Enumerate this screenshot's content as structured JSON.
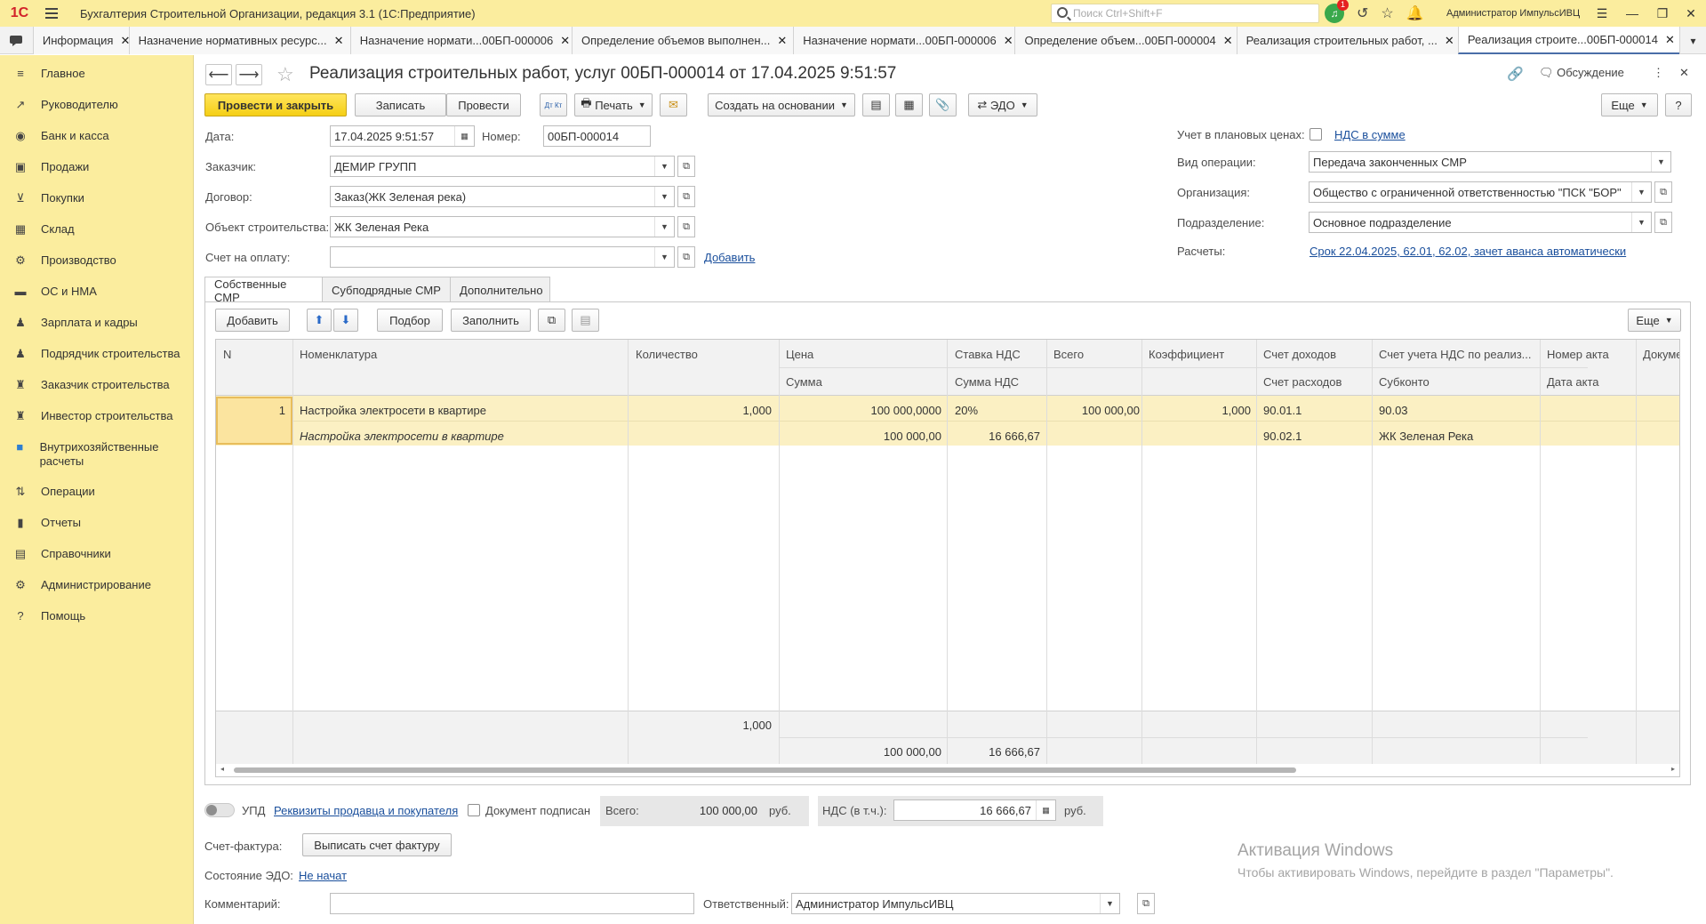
{
  "window": {
    "logo": "1С",
    "app_title": "Бухгалтерия Строительной Организации, редакция 3.1  (1С:Предприятие)",
    "search_placeholder": "Поиск Ctrl+Shift+F",
    "notification_count": "1",
    "user": "Администратор ИмпульсИВЦ"
  },
  "tabs": [
    {
      "label": "Информация"
    },
    {
      "label": "Назначение нормативных ресурс..."
    },
    {
      "label": "Назначение нормати...00БП-000006"
    },
    {
      "label": "Определение объемов выполнен..."
    },
    {
      "label": "Назначение нормати...00БП-000006"
    },
    {
      "label": "Определение объем...00БП-000004"
    },
    {
      "label": "Реализация строительных работ, ..."
    },
    {
      "label": "Реализация строите...00БП-000014"
    }
  ],
  "sidebar": {
    "items": [
      {
        "label": "Главное",
        "icon": "≡"
      },
      {
        "label": "Руководителю",
        "icon": "↗"
      },
      {
        "label": "Банк и касса",
        "icon": "◉"
      },
      {
        "label": "Продажи",
        "icon": "▣"
      },
      {
        "label": "Покупки",
        "icon": "⊻"
      },
      {
        "label": "Склад",
        "icon": "▦"
      },
      {
        "label": "Производство",
        "icon": "⚙"
      },
      {
        "label": "ОС и НМА",
        "icon": "▬"
      },
      {
        "label": "Зарплата и кадры",
        "icon": "♟"
      },
      {
        "label": "Подрядчик строительства",
        "icon": "♟"
      },
      {
        "label": "Заказчик строительства",
        "icon": "♜"
      },
      {
        "label": "Инвестор строительства",
        "icon": "♜"
      },
      {
        "label": "Внутрихозяйственные расчеты",
        "icon": "■"
      },
      {
        "label": "Операции",
        "icon": "⇅"
      },
      {
        "label": "Отчеты",
        "icon": "▮"
      },
      {
        "label": "Справочники",
        "icon": "▤"
      },
      {
        "label": "Администрирование",
        "icon": "⚙"
      },
      {
        "label": "Помощь",
        "icon": "?"
      }
    ]
  },
  "header": {
    "title": "Реализация строительных работ, услуг 00БП-000014 от 17.04.2025 9:51:57",
    "discussion": "Обсуждение"
  },
  "toolbar": {
    "post_close": "Провести и закрыть",
    "save": "Записать",
    "post": "Провести",
    "dt_kt": "Дт Кт",
    "print": "Печать",
    "create_based": "Создать на основании",
    "edo": "ЭДО",
    "more": "Еще",
    "help": "?"
  },
  "fields": {
    "date_label": "Дата:",
    "date_value": "17.04.2025  9:51:57",
    "number_label": "Номер:",
    "number_value": "00БП-000014",
    "customer_label": "Заказчик:",
    "customer_value": "ДЕМИР ГРУПП",
    "contract_label": "Договор:",
    "contract_value": "Заказ(ЖК Зеленая река)",
    "object_label": "Объект строительства:",
    "object_value": "ЖК Зеленая Река",
    "invoice_label": "Счет на оплату:",
    "invoice_value": "",
    "add_link": "Добавить",
    "planned_prices_label": "Учет в плановых ценах:",
    "vat_in_sum_link": "НДС в сумме",
    "operation_label": "Вид операции:",
    "operation_value": "Передача законченных СМР",
    "organization_label": "Организация:",
    "organization_value": "Общество с ограниченной ответственностью \"ПСК \"БОР\"",
    "division_label": "Подразделение:",
    "division_value": "Основное подразделение",
    "settlements_label": "Расчеты:",
    "settlements_link": "Срок 22.04.2025, 62.01, 62.02, зачет аванса автоматически"
  },
  "inner_tabs": [
    {
      "label": "Собственные СМР"
    },
    {
      "label": "Субподрядные СМР"
    },
    {
      "label": "Дополнительно"
    }
  ],
  "table_toolbar": {
    "add": "Добавить",
    "pick": "Подбор",
    "fill": "Заполнить",
    "more": "Еще"
  },
  "table": {
    "headers_top": [
      "N",
      "Номенклатура",
      "Количество",
      "Цена",
      "Ставка НДС",
      "Всего",
      "Коэффициент",
      "Счет доходов",
      "Счет учета НДС по реализ...",
      "Номер акта",
      "Докуме"
    ],
    "headers_bottom": [
      "Сумма",
      "Сумма НДС",
      "Счет расходов",
      "Субконто",
      "Дата акта"
    ],
    "rows": [
      {
        "n": "1",
        "nomenclature": "Настройка электросети в квартире",
        "nomenclature_sub": "Настройка электросети в квартире",
        "qty": "1,000",
        "price": "100 000,0000",
        "sum": "100 000,00",
        "vat_rate": "20%",
        "vat_sum": "16 666,67",
        "total": "100 000,00",
        "coef": "1,000",
        "income_acc": "90.01.1",
        "expense_acc": "90.02.1",
        "vat_acc": "90.03",
        "subconto": "ЖК Зеленая Река"
      }
    ],
    "footer": {
      "qty": "1,000",
      "sum": "100 000,00",
      "vat_sum": "16 666,67"
    }
  },
  "bottom": {
    "upd_label": "УПД",
    "seller_buyer_link": "Реквизиты продавца и покупателя",
    "doc_signed_label": "Документ подписан",
    "total_label": "Всего:",
    "total_value": "100 000,00",
    "currency": "руб.",
    "vat_label": "НДС (в т.ч.):",
    "vat_value": "16 666,67",
    "vat_currency": "руб.",
    "invoice_label": "Счет-фактура:",
    "invoice_btn": "Выписать счет фактуру",
    "edo_state_label": "Состояние ЭДО:",
    "edo_state_link": "Не начат",
    "comment_label": "Комментарий:",
    "comment_value": "",
    "responsible_label": "Ответственный:",
    "responsible_value": "Администратор ИмпульсИВЦ"
  },
  "watermark": {
    "title": "Активация Windows",
    "text": "Чтобы активировать Windows, перейдите в раздел \"Параметры\"."
  }
}
